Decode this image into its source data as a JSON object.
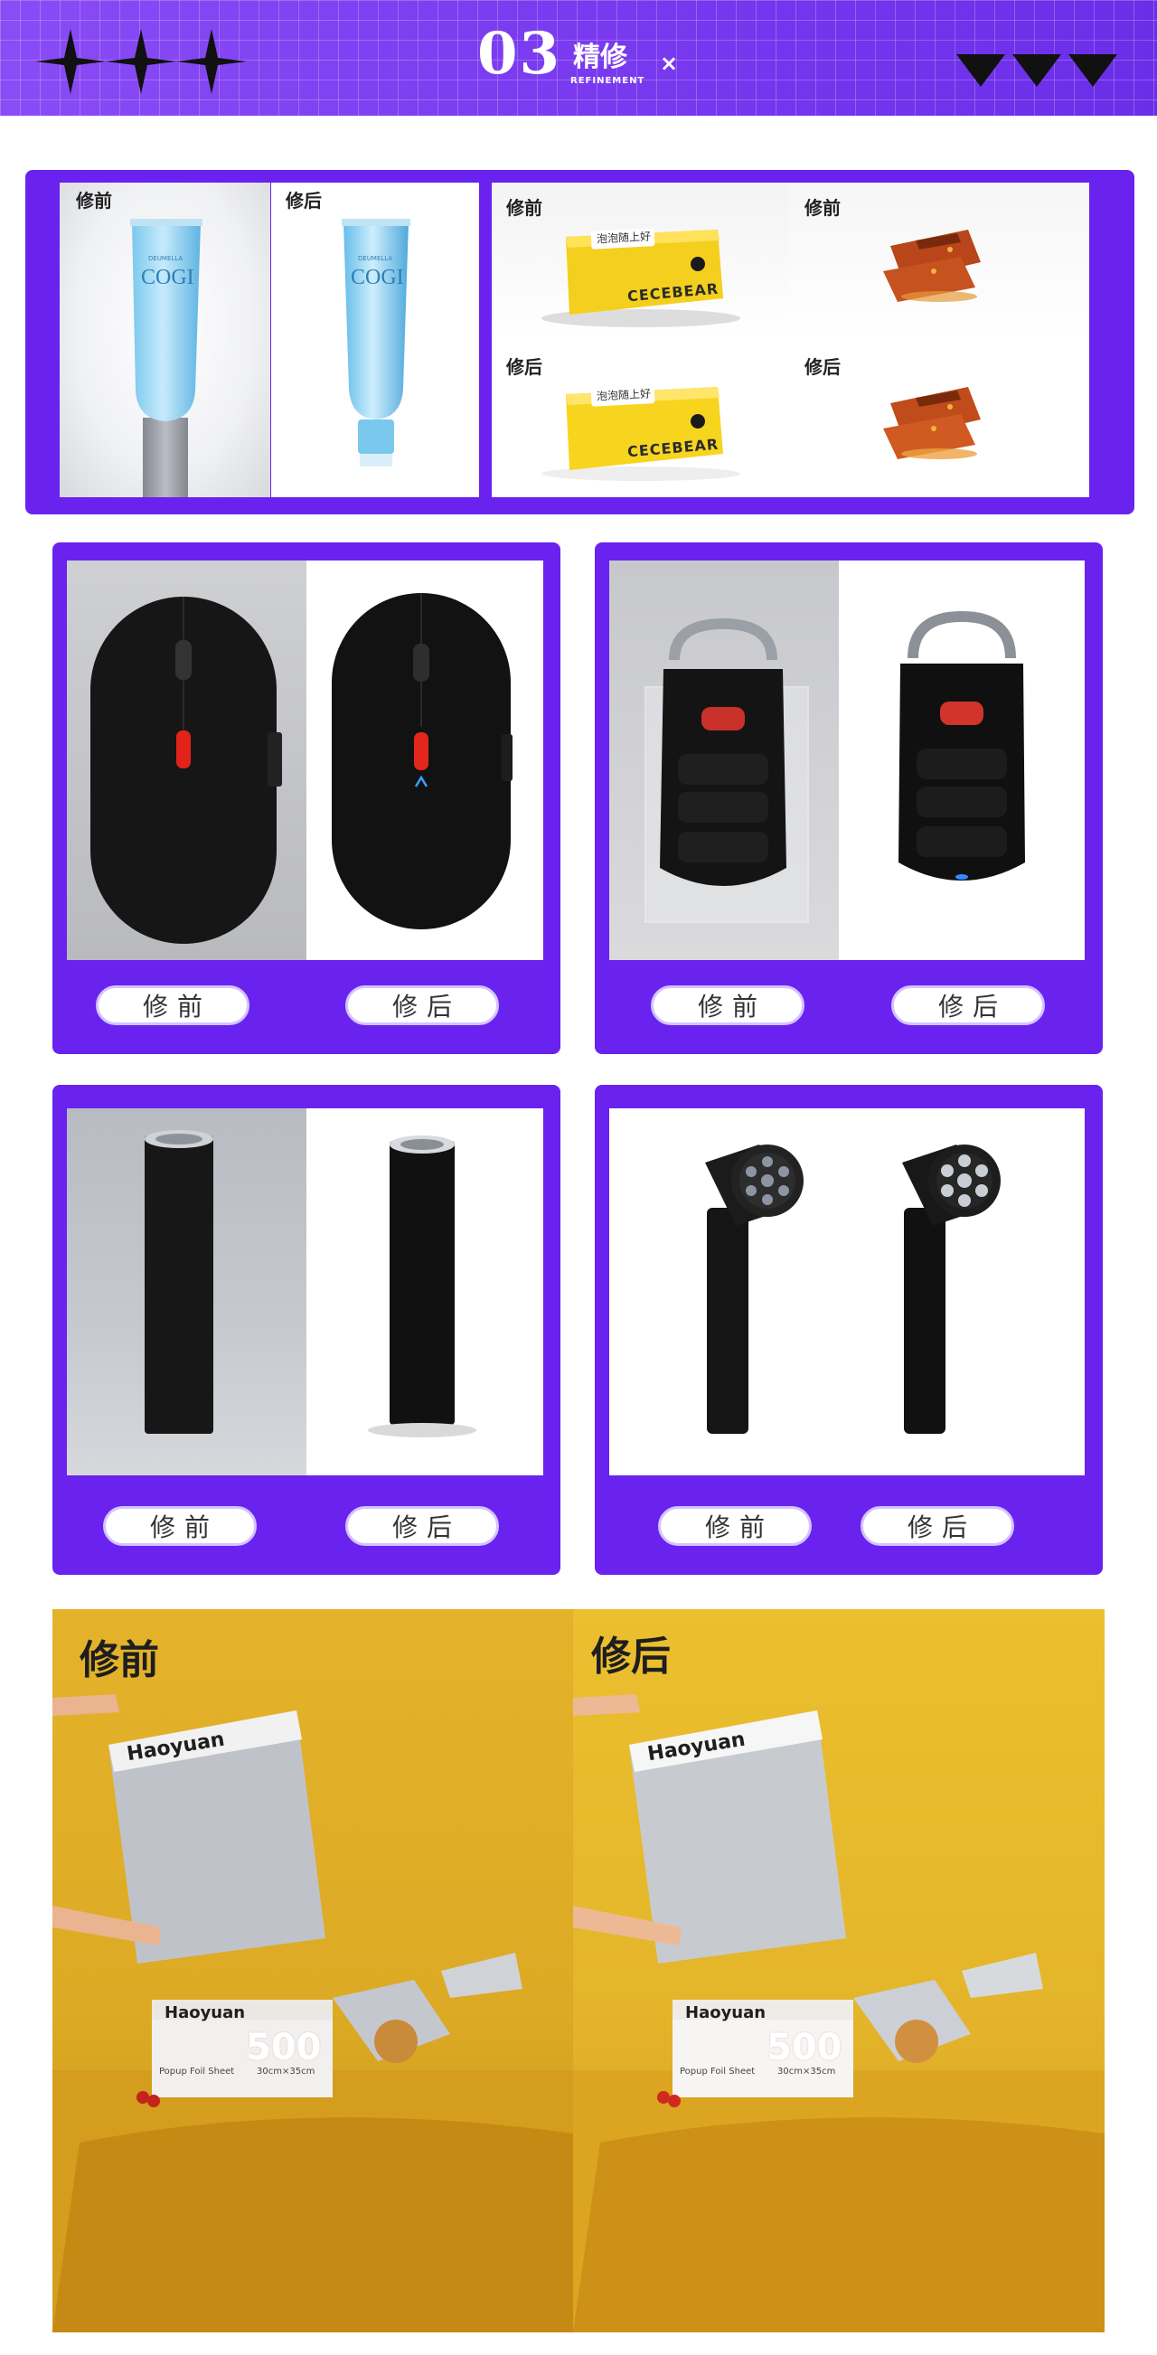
{
  "header": {
    "number": "03",
    "title": "精修",
    "subtitle": "REFINEMENT",
    "mark": "×"
  },
  "labels": {
    "before": "修前",
    "after": "修后"
  },
  "products": {
    "tube_brand": "COGI",
    "tube_small": "DEUMELLA",
    "soap_brand": "CECEBEAR",
    "soap_tag": "泡泡随上好",
    "foil_brand": "Haoyuan",
    "foil_box_line1": "Popup Foil Sheet",
    "foil_box_count": "500",
    "foil_box_size": "30cm×35cm"
  },
  "colors": {
    "accent": "#6a22ef",
    "header": "#7b3cf0",
    "pill_border": "#d4c3ff",
    "yellow_bg": "#e3b82a"
  }
}
